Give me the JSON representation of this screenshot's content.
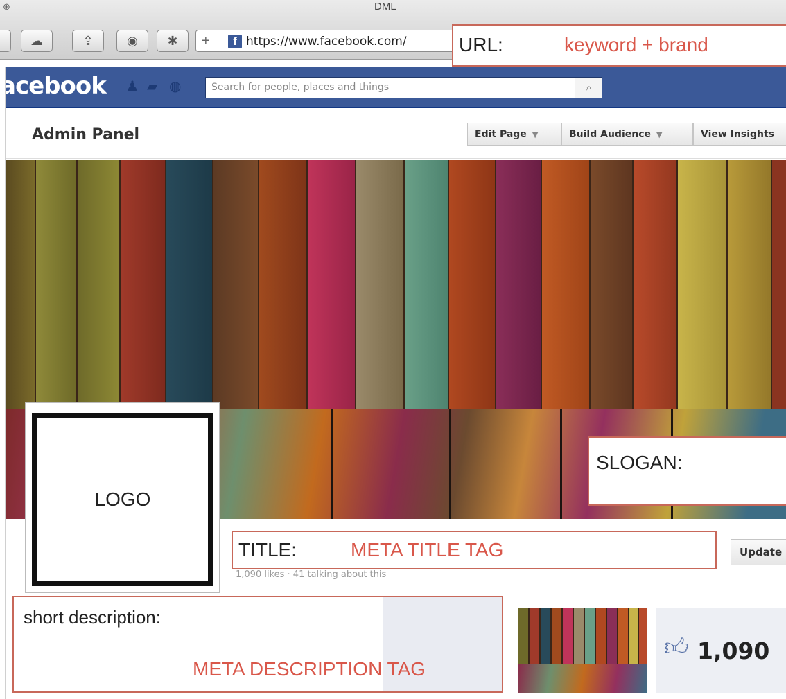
{
  "window": {
    "title": "DML"
  },
  "toolbar": {
    "buttons": [
      {
        "name": "back-button",
        "icon": "back-icon",
        "glyph": ""
      },
      {
        "name": "icloud-button",
        "icon": "cloud-icon",
        "glyph": "☁"
      },
      {
        "name": "share-button",
        "icon": "share-icon",
        "glyph": "⇪"
      },
      {
        "name": "reading-list-button",
        "icon": "eye-icon",
        "glyph": "◉"
      },
      {
        "name": "extensions-button",
        "icon": "asterisk-icon",
        "glyph": "✱"
      }
    ],
    "new_tab_glyph": "+",
    "url": "https://www.facebook.com/",
    "favicon_letter": "f"
  },
  "annotations": {
    "url_label": "URL:",
    "url_value": "keyword + brand",
    "slogan_label": "SLOGAN:",
    "logo_label": "LOGO",
    "title_label": "TITLE:",
    "title_value": "META TITLE TAG",
    "description_label": "short description:",
    "description_value": "META DESCRIPTION TAG"
  },
  "facebook": {
    "logo_text": "acebook",
    "search_placeholder": "Search for people, places and things",
    "admin_title": "Admin Panel",
    "admin_buttons": [
      {
        "label": "Edit Page"
      },
      {
        "label": "Build Audience"
      },
      {
        "label": "View Insights"
      }
    ],
    "likes_line": "1,090 likes · 41 talking about this",
    "update_button": "Update",
    "likes_count": "1,090"
  },
  "colors": {
    "facebook_blue": "#3b5998",
    "annotation_red": "#d9574a",
    "annotation_border": "#c8685a"
  }
}
